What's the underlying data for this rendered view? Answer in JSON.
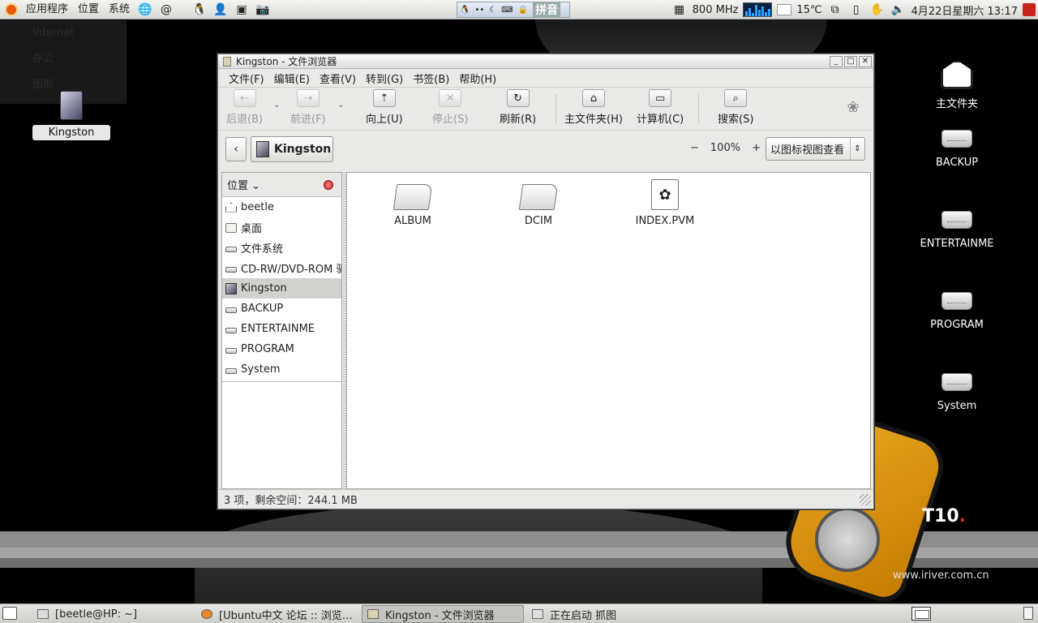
{
  "top_panel": {
    "menus": [
      "应用程序",
      "位置",
      "系统"
    ],
    "ime_label": "拼音",
    "cpu_freq": "800 MHz",
    "temperature": "15℃",
    "clock": "4月22日星期六 13:17"
  },
  "bg_menu": {
    "items": [
      "Internet",
      "办公",
      "图形"
    ]
  },
  "desktop_icons": {
    "kingston": "Kingston",
    "home": "主文件夹",
    "backup": "BACKUP",
    "entertainment": "ENTERTAINME",
    "program": "PROGRAM",
    "system": "System"
  },
  "window": {
    "title": "Kingston - 文件浏览器",
    "menu": [
      "文件(F)",
      "编辑(E)",
      "查看(V)",
      "转到(G)",
      "书签(B)",
      "帮助(H)"
    ],
    "toolbar": {
      "back": "后退(B)",
      "forward": "前进(F)",
      "up": "向上(U)",
      "stop": "停止(S)",
      "reload": "刷新(R)",
      "home": "主文件夹(H)",
      "computer": "计算机(C)",
      "search": "搜索(S)"
    },
    "location": {
      "crumb": "Kingston",
      "zoom_out": "−",
      "zoom_level": "100%",
      "zoom_in": "+",
      "view_mode": "以图标视图查看"
    },
    "sidebar": {
      "header": "位置",
      "items": [
        "beetle",
        "桌面",
        "文件系统",
        "CD-RW/DVD-ROM 驱",
        "Kingston",
        "BACKUP",
        "ENTERTAINME",
        "PROGRAM",
        "System"
      ]
    },
    "files": [
      "ALBUM",
      "DCIM",
      "INDEX.PVM"
    ],
    "status": "3 项，剩余空间：244.1 MB"
  },
  "wallpaper": {
    "brand": "T10",
    "url": "www.iriver.com.cn"
  },
  "bottom_panel": {
    "tasks": [
      "[beetle@HP: ~]",
      "[Ubuntu中文 论坛 :: 浏览…",
      "Kingston - 文件浏览器",
      "正在启动 抓图"
    ]
  }
}
